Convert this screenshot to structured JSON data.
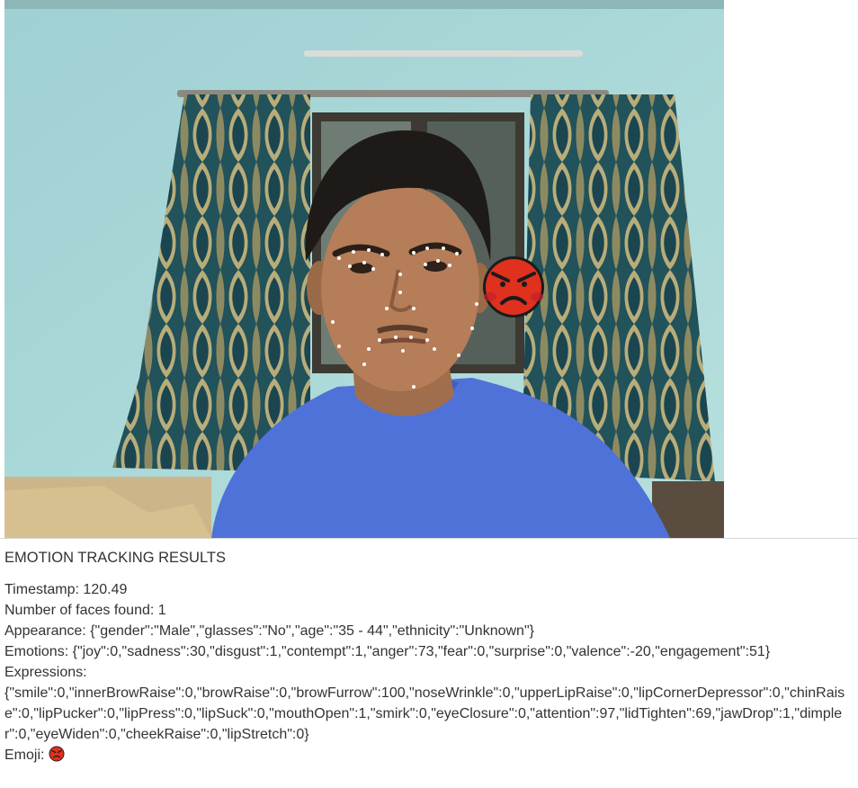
{
  "results": {
    "heading": "EMOTION TRACKING RESULTS",
    "timestamp_label": "Timestamp: ",
    "timestamp": "120.49",
    "faces_label": "Number of faces found: ",
    "faces": "1",
    "appearance_label": "Appearance: ",
    "appearance": "{\"gender\":\"Male\",\"glasses\":\"No\",\"age\":\"35 - 44\",\"ethnicity\":\"Unknown\"}",
    "emotions_label": "Emotions: ",
    "emotions": "{\"joy\":0,\"sadness\":30,\"disgust\":1,\"contempt\":1,\"anger\":73,\"fear\":0,\"surprise\":0,\"valence\":-20,\"engagement\":51}",
    "expressions_label": "Expressions:",
    "expressions": "{\"smile\":0,\"innerBrowRaise\":0,\"browRaise\":0,\"browFurrow\":100,\"noseWrinkle\":0,\"upperLipRaise\":0,\"lipCornerDepressor\":0,\"chinRaise\":0,\"lipPucker\":0,\"lipPress\":0,\"lipSuck\":0,\"mouthOpen\":1,\"smirk\":0,\"eyeClosure\":0,\"attention\":97,\"lidTighten\":69,\"jawDrop\":1,\"dimpler\":0,\"eyeWiden\":0,\"cheekRaise\":0,\"lipStretch\":0}",
    "emoji_label": "Emoji: ",
    "emoji_icon": "angry-face-emoji"
  },
  "colors": {
    "wall": "#a9d6d6",
    "curtain": "#1f4d55",
    "shirt": "#4f72d8",
    "emoji_red": "#e0301e",
    "text": "#333333"
  }
}
